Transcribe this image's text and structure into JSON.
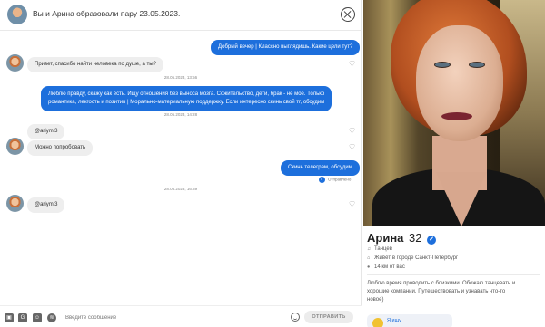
{
  "header": {
    "title": "Вы и Арина образовали пару 23.05.2023."
  },
  "messages": [
    {
      "type": "out",
      "text": "Добрый вечер | Классно выглядишь. Какие цели тут?"
    },
    {
      "type": "in",
      "text": "Привет, спасибо найти человека по душе, а ты?"
    },
    {
      "type": "timestamp",
      "text": "28.05.2023, 13:56"
    },
    {
      "type": "out",
      "lines": [
        "Люблю правду, скажу как есть. Ищу отношения без выноса мозга. Сожительство, дети, брак - не мое. Только",
        "романтика, лекгость и позитив | Морально-материальную поддержку. Если интересно скинь свой тг, обсудим"
      ]
    },
    {
      "type": "timestamp",
      "text": "28.05.2023, 14:28"
    },
    {
      "type": "in",
      "text": "@ariymi3"
    },
    {
      "type": "in",
      "text": "Можно попробовать"
    },
    {
      "type": "out",
      "text": "Скинь телеграм, обсудим"
    },
    {
      "type": "status",
      "text": "Отправлено"
    },
    {
      "type": "timestamp",
      "text": "28.05.2023, 16:39"
    },
    {
      "type": "in",
      "text": "@ariymi3"
    }
  ],
  "composer": {
    "placeholder": "Введите сообщение",
    "send_label": "ОТПРАВИТЬ"
  },
  "profile": {
    "name": "Арина",
    "age": "32",
    "details": [
      {
        "icon": "headphones-icon",
        "text": "Танцев"
      },
      {
        "icon": "home-icon",
        "text": "Живёт в городе Санкт-Петербург"
      },
      {
        "icon": "location-pin-icon",
        "text": "14 км от вас"
      }
    ],
    "bio_lines": [
      "Люблю время проводить с близкими. Обожаю танцевать и",
      "хорошие компании. Путешествовать и узнавать что-то",
      "новое)"
    ],
    "looking_for": "Я ищу"
  },
  "colors": {
    "accent": "#1d6fdc",
    "incoming_bubble": "#eeeeee"
  }
}
